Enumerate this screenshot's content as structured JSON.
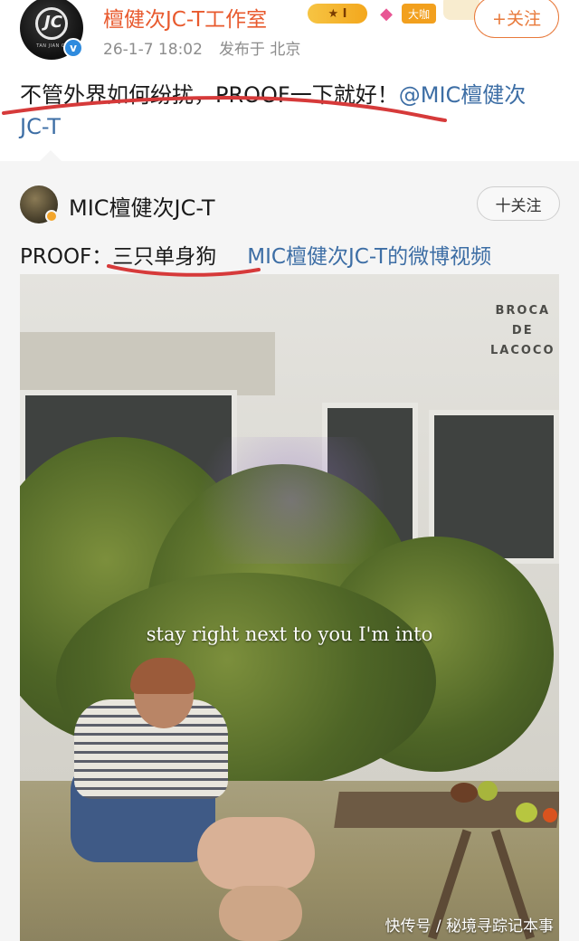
{
  "post": {
    "author_name": "檀健次JC-T工作室",
    "rank_badge": "★ I",
    "daka_badge": "大咖",
    "follow_label": "+关注",
    "timestamp": "26-1-7 18:02",
    "location": "发布于 北京",
    "text_before_mention": "不管外界如何纷扰，PROOF一下就好！",
    "mention": "@MIC檀健次JC-T",
    "avatar_logo": "JC",
    "avatar_caption": "TAN JIAN CI"
  },
  "quoted": {
    "author_name": "MIC檀健次JC-T",
    "follow_label": "十关注",
    "text": "PROOF：三只单身狗",
    "video_link": "MIC檀健次JC-T的微博视频",
    "video": {
      "sign_lines": [
        "BROCA",
        "DE",
        "LACOCO"
      ],
      "subtitle": "stay right next to you I'm into"
    }
  },
  "watermark": "快传号 / 秘境寻踪记本事",
  "colors": {
    "author_name": "#e85a2e",
    "mention": "#3d6ea5",
    "follow_border": "#e8793a",
    "verified": "#2f8bde",
    "underline": "#d63a3a"
  },
  "icons": {
    "verified": "verified-v-icon",
    "diamond": "diamond-icon"
  }
}
